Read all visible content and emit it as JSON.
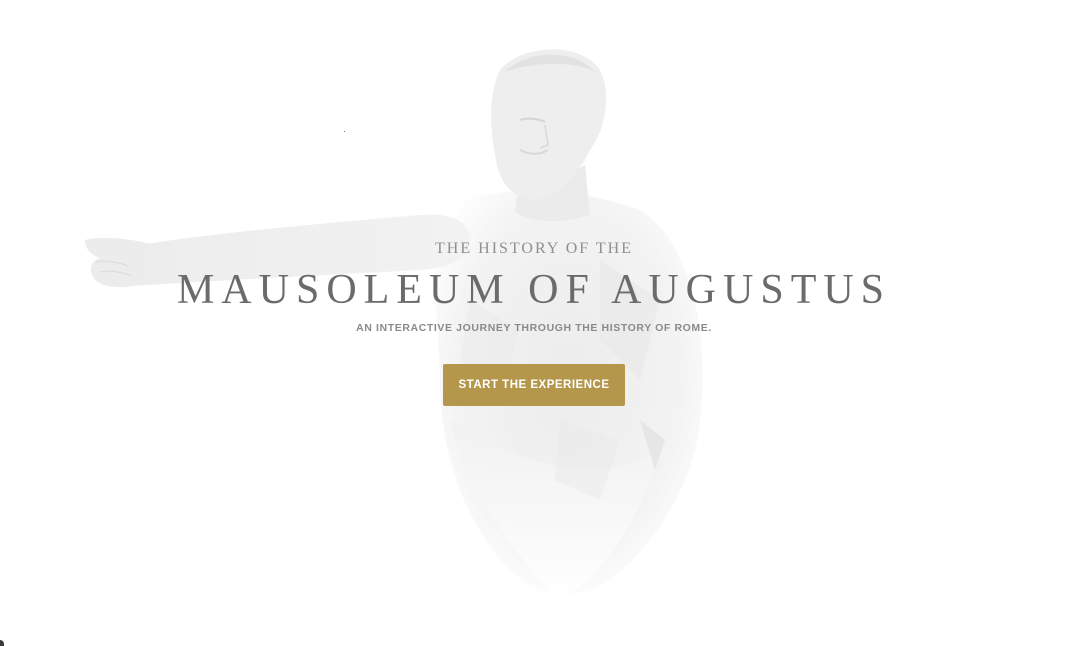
{
  "hero": {
    "kicker": "THE HISTORY OF THE",
    "title": "MAUSOLEUM OF AUGUSTUS",
    "subtitle": "AN INTERACTIVE JOURNEY THROUGH THE HISTORY OF ROME.",
    "cta_label": "START THE EXPERIENCE"
  },
  "colors": {
    "background": "#ffffff",
    "cta_background": "#b5974c",
    "cta_text": "#ffffff",
    "title_text": "#6b6b6b",
    "statue_tint": "#e9e9e9"
  },
  "icons": {
    "background_art": "augustus-statue-illustration"
  }
}
